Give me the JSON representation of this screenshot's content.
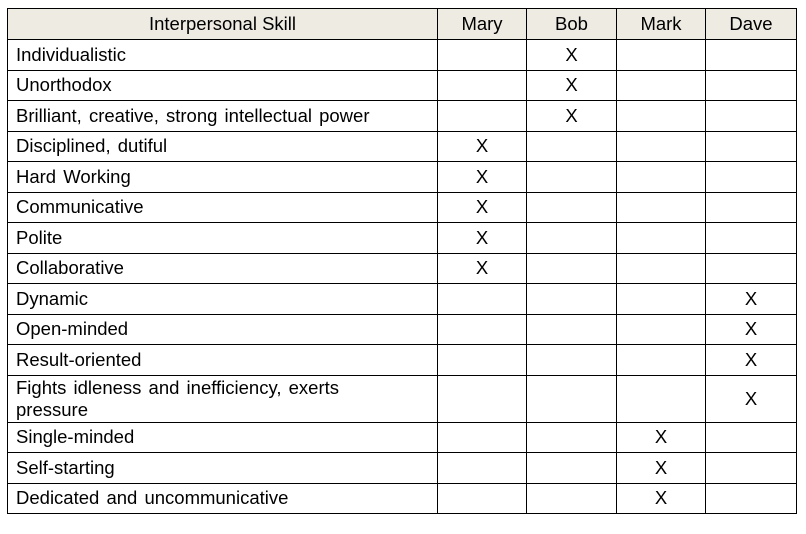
{
  "table": {
    "headers": [
      "Interpersonal Skill",
      "Mary",
      "Bob",
      "Mark",
      "Dave"
    ],
    "mark_symbol": "X",
    "rows": [
      {
        "skill": "Individualistic",
        "cells": [
          "",
          "X",
          "",
          ""
        ]
      },
      {
        "skill": "Unorthodox",
        "cells": [
          "",
          "X",
          "",
          ""
        ]
      },
      {
        "skill": "Brilliant, creative, strong intellectual power",
        "cells": [
          "",
          "X",
          "",
          ""
        ]
      },
      {
        "skill": "Disciplined, dutiful",
        "cells": [
          "X",
          "",
          "",
          ""
        ]
      },
      {
        "skill": "Hard Working",
        "cells": [
          "X",
          "",
          "",
          ""
        ]
      },
      {
        "skill": "Communicative",
        "cells": [
          "X",
          "",
          "",
          ""
        ]
      },
      {
        "skill": "Polite",
        "cells": [
          "X",
          "",
          "",
          ""
        ]
      },
      {
        "skill": "Collaborative",
        "cells": [
          "X",
          "",
          "",
          ""
        ]
      },
      {
        "skill": "Dynamic",
        "cells": [
          "",
          "",
          "",
          "X"
        ]
      },
      {
        "skill": "Open-minded",
        "cells": [
          "",
          "",
          "",
          "X"
        ]
      },
      {
        "skill": "Result-oriented",
        "cells": [
          "",
          "",
          "",
          "X"
        ]
      },
      {
        "skill": "Fights idleness and inefficiency, exerts pressure",
        "cells": [
          "",
          "",
          "",
          "X"
        ]
      },
      {
        "skill": "Single-minded",
        "cells": [
          "",
          "",
          "X",
          ""
        ]
      },
      {
        "skill": "Self-starting",
        "cells": [
          "",
          "",
          "X",
          ""
        ]
      },
      {
        "skill": "Dedicated and uncommunicative",
        "cells": [
          "",
          "",
          "X",
          ""
        ]
      }
    ]
  },
  "colors": {
    "header_background": "#eeebe2",
    "border": "#000000",
    "text": "#000000"
  }
}
